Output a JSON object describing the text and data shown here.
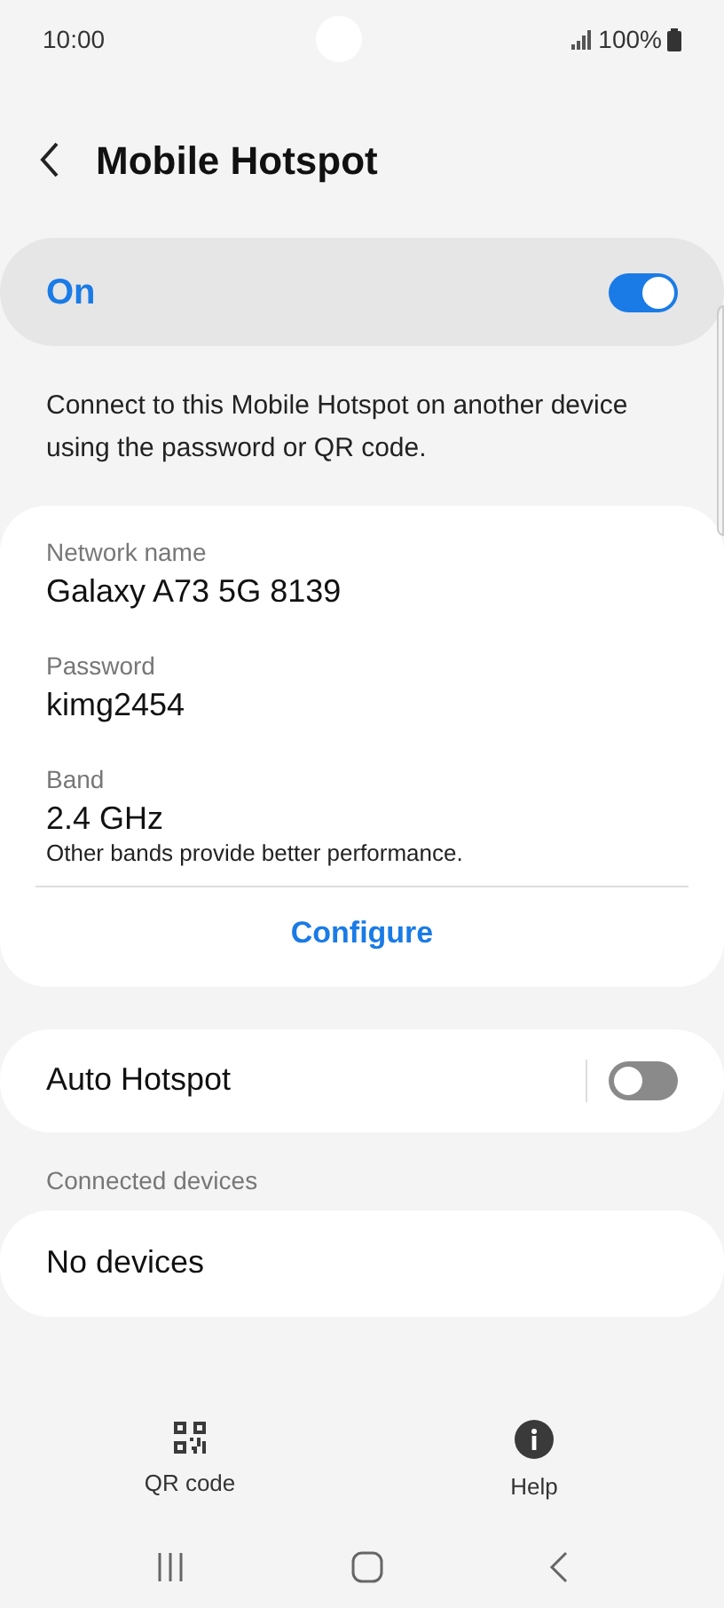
{
  "status_bar": {
    "time": "10:00",
    "battery": "100%"
  },
  "header": {
    "title": "Mobile Hotspot"
  },
  "master_switch": {
    "label": "On",
    "on": true
  },
  "description": "Connect to this Mobile Hotspot on another device using the password or QR code.",
  "settings": [
    {
      "label": "Network name",
      "value": "Galaxy A73 5G 8139"
    },
    {
      "label": "Password",
      "value": "kimg2454"
    },
    {
      "label": "Band",
      "value": "2.4 GHz",
      "note": "Other bands provide better performance."
    }
  ],
  "configure_button": "Configure",
  "auto_hotspot": {
    "label": "Auto Hotspot",
    "on": false
  },
  "connected_devices": {
    "heading": "Connected devices",
    "empty_text": "No devices"
  },
  "bottom_actions": [
    {
      "kind": "qr",
      "label": "QR code"
    },
    {
      "kind": "help",
      "label": "Help"
    }
  ]
}
